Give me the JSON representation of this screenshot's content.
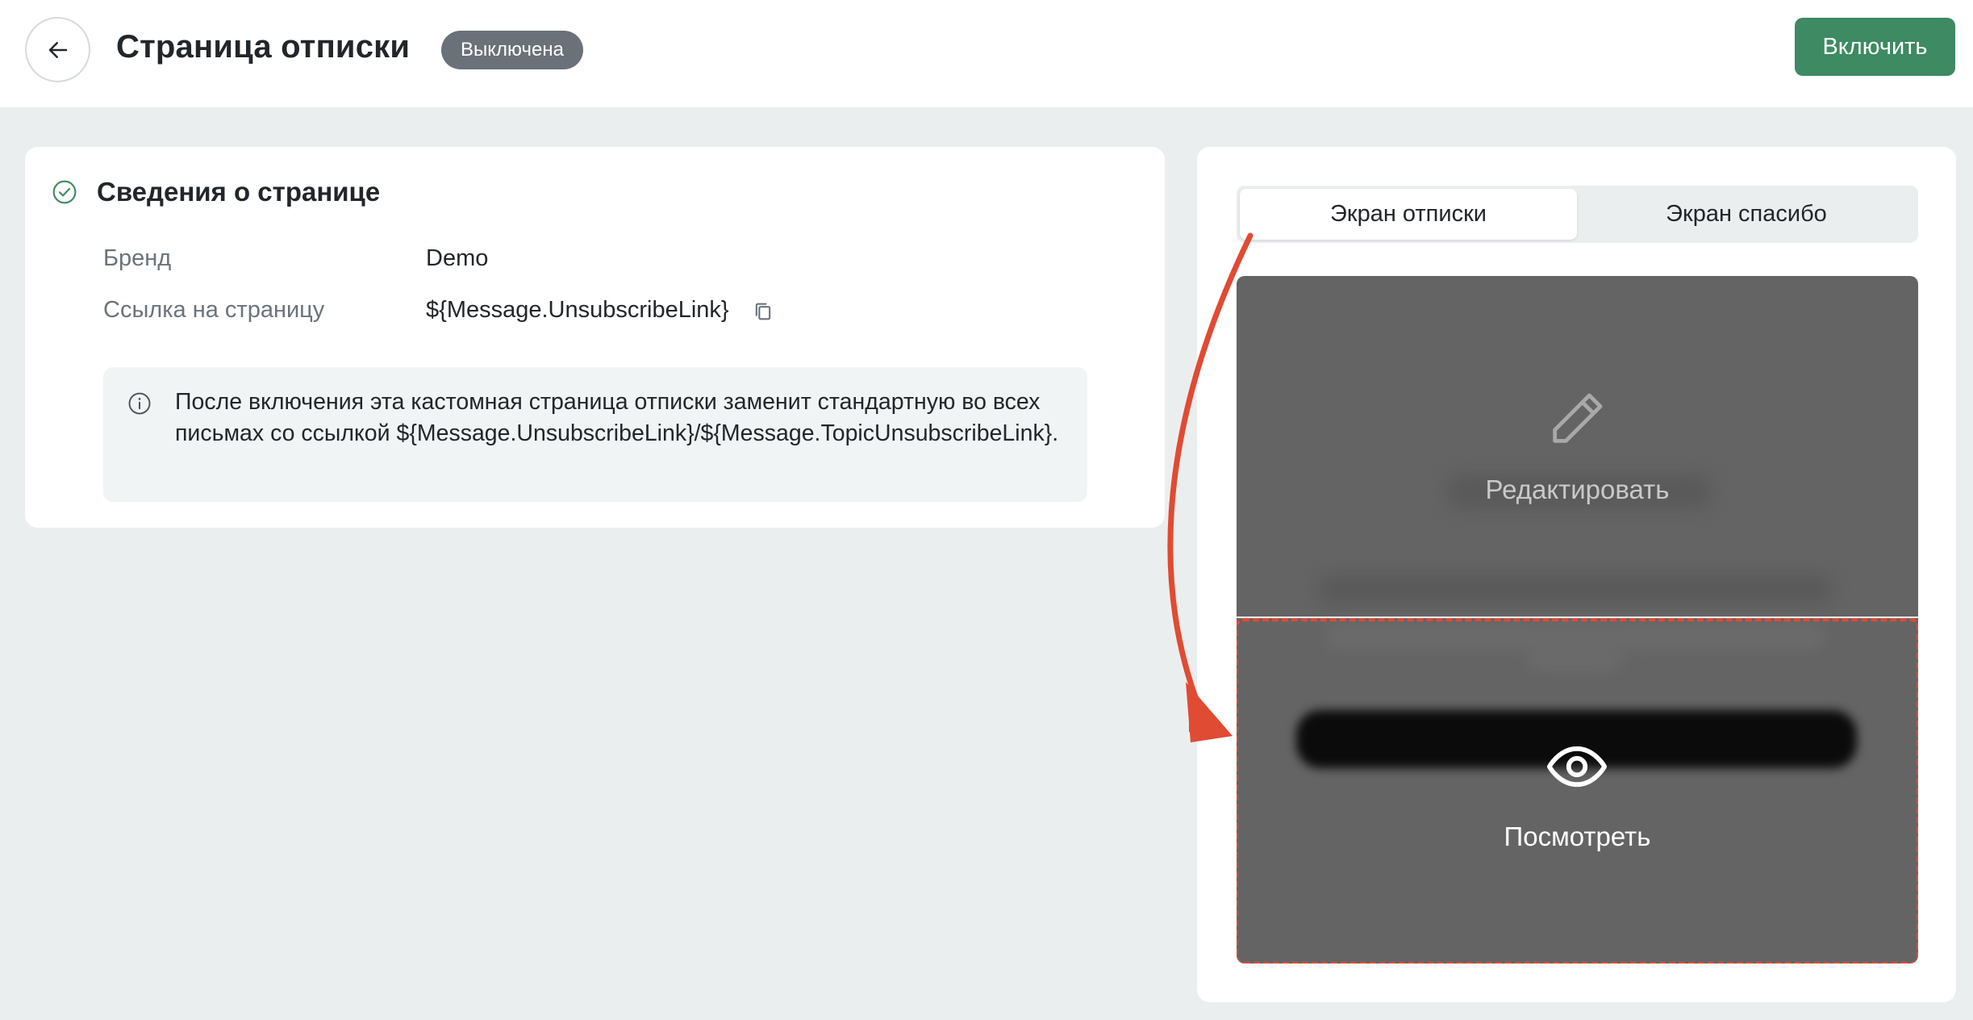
{
  "header": {
    "title": "Страница отписки",
    "status": "Выключена",
    "enable_label": "Включить"
  },
  "info": {
    "section_title": "Сведения о странице",
    "fields": [
      {
        "label": "Бренд",
        "value": "Demo"
      },
      {
        "label": "Ссылка на страницу",
        "value": "${Message.UnsubscribeLink}"
      }
    ],
    "note": "После включения эта кастомная страница отписки заменит стандартную во всех письмах со ссылкой ${Message.UnsubscribeLink}/${Message.TopicUnsubscribeLink}."
  },
  "preview": {
    "tabs": [
      {
        "label": "Экран отписки",
        "active": true
      },
      {
        "label": "Экран спасибо",
        "active": false
      }
    ],
    "edit_label": "Редактировать",
    "view_label": "Посмотреть"
  },
  "colors": {
    "accent_green": "#3d8a63",
    "badge_gray": "#6a7178",
    "highlight_red": "#e04b33",
    "preview_bg": "#646464"
  },
  "icons": [
    "arrow-left-icon",
    "check-circle-icon",
    "copy-icon",
    "info-icon",
    "pencil-icon",
    "eye-icon"
  ]
}
